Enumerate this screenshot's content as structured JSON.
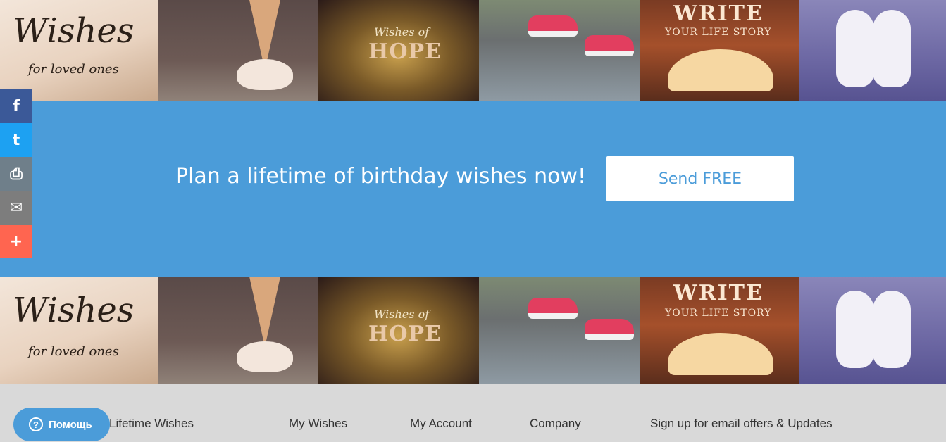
{
  "banner": {
    "tiles": [
      {
        "line1": "Wishes",
        "line2": "for loved ones"
      },
      {
        "line1": "",
        "line2": ""
      },
      {
        "line1": "Wishes of",
        "line2": "HOPE"
      },
      {
        "line1": "",
        "line2": ""
      },
      {
        "line1": "WRITE",
        "line2": "YOUR LIFE STORY"
      },
      {
        "line1": "",
        "line2": ""
      }
    ]
  },
  "cta": {
    "headline": "Plan a lifetime of birthday wishes now!",
    "button_label": "Send FREE"
  },
  "social": {
    "items": [
      {
        "glyph": "f",
        "icon": "facebook-icon"
      },
      {
        "glyph": "t",
        "icon": "twitter-icon"
      },
      {
        "glyph": "⎙",
        "icon": "print-icon"
      },
      {
        "glyph": "✉",
        "icon": "email-icon"
      },
      {
        "glyph": "+",
        "icon": "more-icon"
      }
    ]
  },
  "footer": {
    "links": [
      "Lifetime Wishes",
      "My Wishes",
      "My Account",
      "Company",
      "Sign up for email offers & Updates"
    ]
  },
  "help": {
    "label": "Помощь",
    "icon_glyph": "?"
  }
}
